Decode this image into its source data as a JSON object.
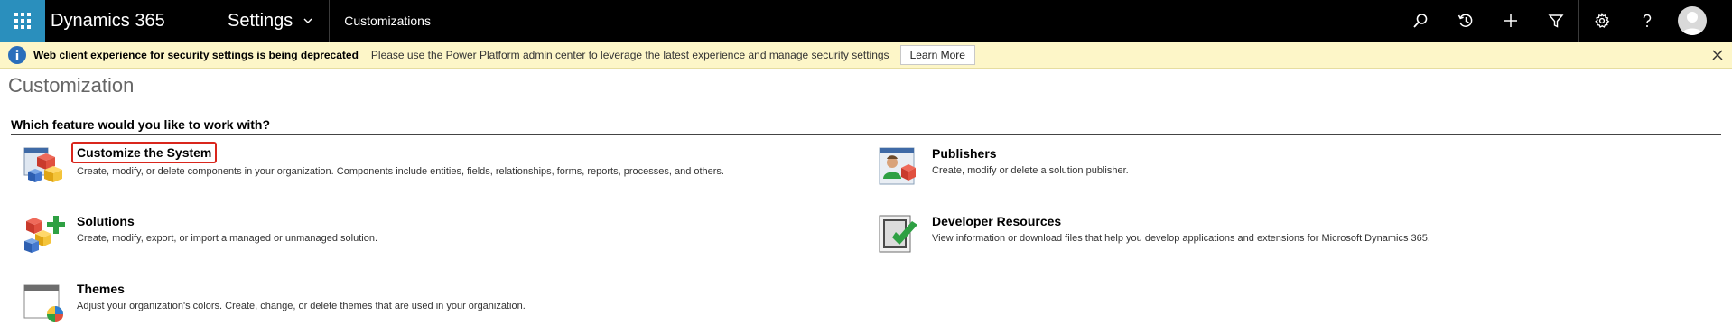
{
  "nav": {
    "brand": "Dynamics 365",
    "area": "Settings",
    "breadcrumb": "Customizations",
    "icons": [
      "search-icon",
      "recent-icon",
      "new-icon",
      "filter-icon",
      "settings-icon",
      "help-icon",
      "user-avatar-icon"
    ]
  },
  "notification": {
    "title": "Web client experience for security settings is being deprecated",
    "message": "Please use the Power Platform admin center to leverage the latest experience and manage security settings",
    "button_label": "Learn More"
  },
  "page": {
    "title": "Customization",
    "section_heading": "Which feature would you like to work with?"
  },
  "features": [
    {
      "title": "Customize the System",
      "description": "Create, modify, or delete components in your organization. Components include entities, fields, relationships, forms, reports, processes, and others.",
      "icon": "customize-system-icon",
      "highlighted": true
    },
    {
      "title": "Publishers",
      "description": "Create, modify or delete a solution publisher.",
      "icon": "publishers-icon",
      "highlighted": false
    },
    {
      "title": "Solutions",
      "description": "Create, modify, export, or import a managed or unmanaged solution.",
      "icon": "solutions-icon",
      "highlighted": false
    },
    {
      "title": "Developer Resources",
      "description": "View information or download files that help you develop applications and extensions for Microsoft Dynamics 365.",
      "icon": "developer-resources-icon",
      "highlighted": false
    },
    {
      "title": "Themes",
      "description": "Adjust your organization's colors. Create, change, or delete themes that are used in your organization.",
      "icon": "themes-icon",
      "highlighted": false
    }
  ],
  "colors": {
    "nav_background": "#000000",
    "waffle_background": "#2a8fbd",
    "notice_background": "#fdf6c8",
    "highlight_border": "#d9261c"
  }
}
